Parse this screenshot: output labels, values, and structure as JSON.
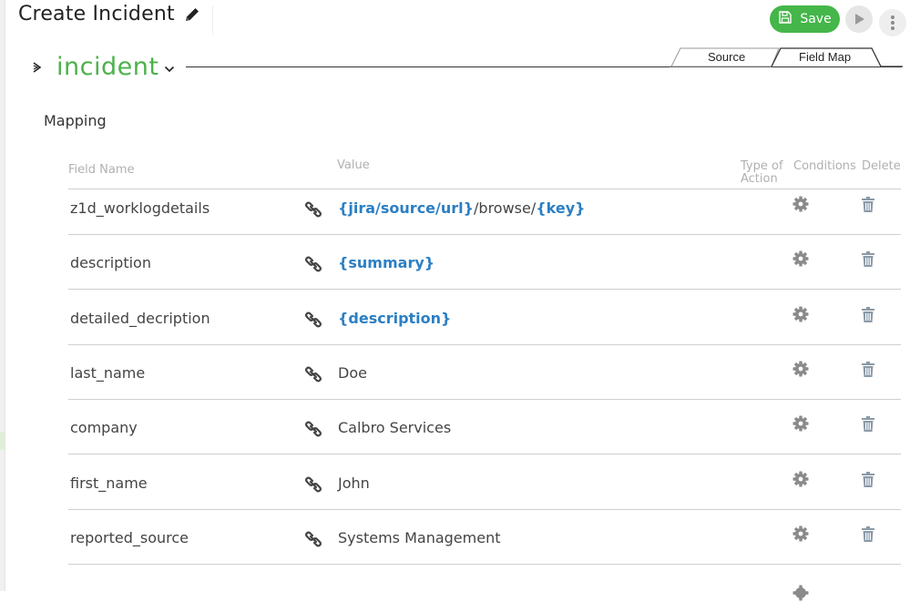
{
  "page": {
    "title": "Create Incident"
  },
  "toolbar": {
    "save_label": "Save"
  },
  "object": {
    "name": "incident"
  },
  "tabs": [
    {
      "label": "Source",
      "active": false
    },
    {
      "label": "Field Map",
      "active": true
    }
  ],
  "section": {
    "title": "Mapping"
  },
  "columns": {
    "field_name": "Field Name",
    "value": "Value",
    "type_of_action": "Type of Action",
    "conditions": "Conditions",
    "delete": "Delete"
  },
  "rows": [
    {
      "field": "z1d_worklogdetails",
      "value": [
        {
          "t": "{jira/source/url}",
          "tok": true
        },
        {
          "t": "/browse/",
          "tok": false
        },
        {
          "t": "{key}",
          "tok": true
        }
      ]
    },
    {
      "field": "description",
      "value": [
        {
          "t": "{summary}",
          "tok": true
        }
      ]
    },
    {
      "field": "detailed_decription",
      "value": [
        {
          "t": "{description}",
          "tok": true
        }
      ]
    },
    {
      "field": "last_name",
      "value": [
        {
          "t": " Doe",
          "tok": false
        }
      ]
    },
    {
      "field": "company",
      "value": [
        {
          "t": " Calbro Services",
          "tok": false
        }
      ]
    },
    {
      "field": "first_name",
      "value": [
        {
          "t": " John",
          "tok": false
        }
      ]
    },
    {
      "field": "reported_source",
      "value": [
        {
          "t": "Systems Management",
          "tok": false
        }
      ]
    }
  ],
  "colors": {
    "accent_green": "#45b649",
    "object_green": "#4bb24a",
    "token_blue": "#2b7fc4",
    "icon_gray": "#8a8a8a"
  },
  "icons": {
    "edit": "pencil-icon",
    "save": "floppy-icon",
    "run": "play-icon",
    "more": "vertical-ellipsis-icon",
    "expand": "chevron-right-icon",
    "dropdown": "chevron-down-icon",
    "row_link": "link-icon",
    "row_conditions": "gear-icon",
    "row_delete": "trash-icon"
  }
}
